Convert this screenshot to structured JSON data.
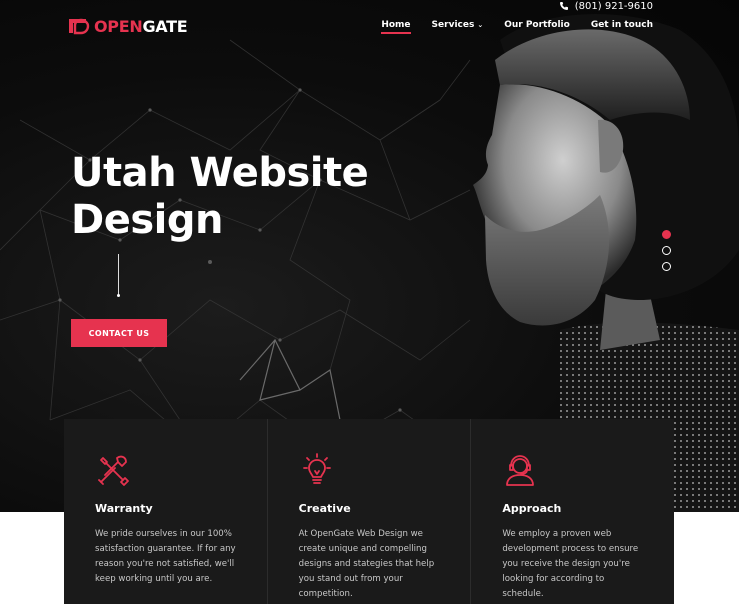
{
  "header": {
    "logo": {
      "prefix": "OPEN",
      "suffix": "GATE"
    },
    "phone": "(801) 921-9610",
    "nav": [
      {
        "label": "Home",
        "active": true
      },
      {
        "label": "Services",
        "has_dropdown": true
      },
      {
        "label": "Our Portfolio"
      },
      {
        "label": "Get in touch"
      }
    ]
  },
  "hero": {
    "title_line1": "Utah Website",
    "title_line2": "Design",
    "cta_label": "CONTACT US",
    "slider_dots": 3,
    "active_slide": 1
  },
  "features": [
    {
      "icon": "tools-icon",
      "title": "Warranty",
      "text": "We pride ourselves in our 100% satisfaction guarantee. If for any reason you're not satisfied, we'll keep working until you are."
    },
    {
      "icon": "lightbulb-icon",
      "title": "Creative",
      "text": "At OpenGate Web Design we create unique and compelling designs and stategies that help you stand out from your competition."
    },
    {
      "icon": "support-agent-icon",
      "title": "Approach",
      "text": "We employ a proven web development process to ensure you receive the design you're looking for according to schedule."
    }
  ],
  "colors": {
    "accent": "#e6334f",
    "background": "#0c0c0c",
    "panel": "#1a1a1a",
    "text": "#ffffff"
  }
}
